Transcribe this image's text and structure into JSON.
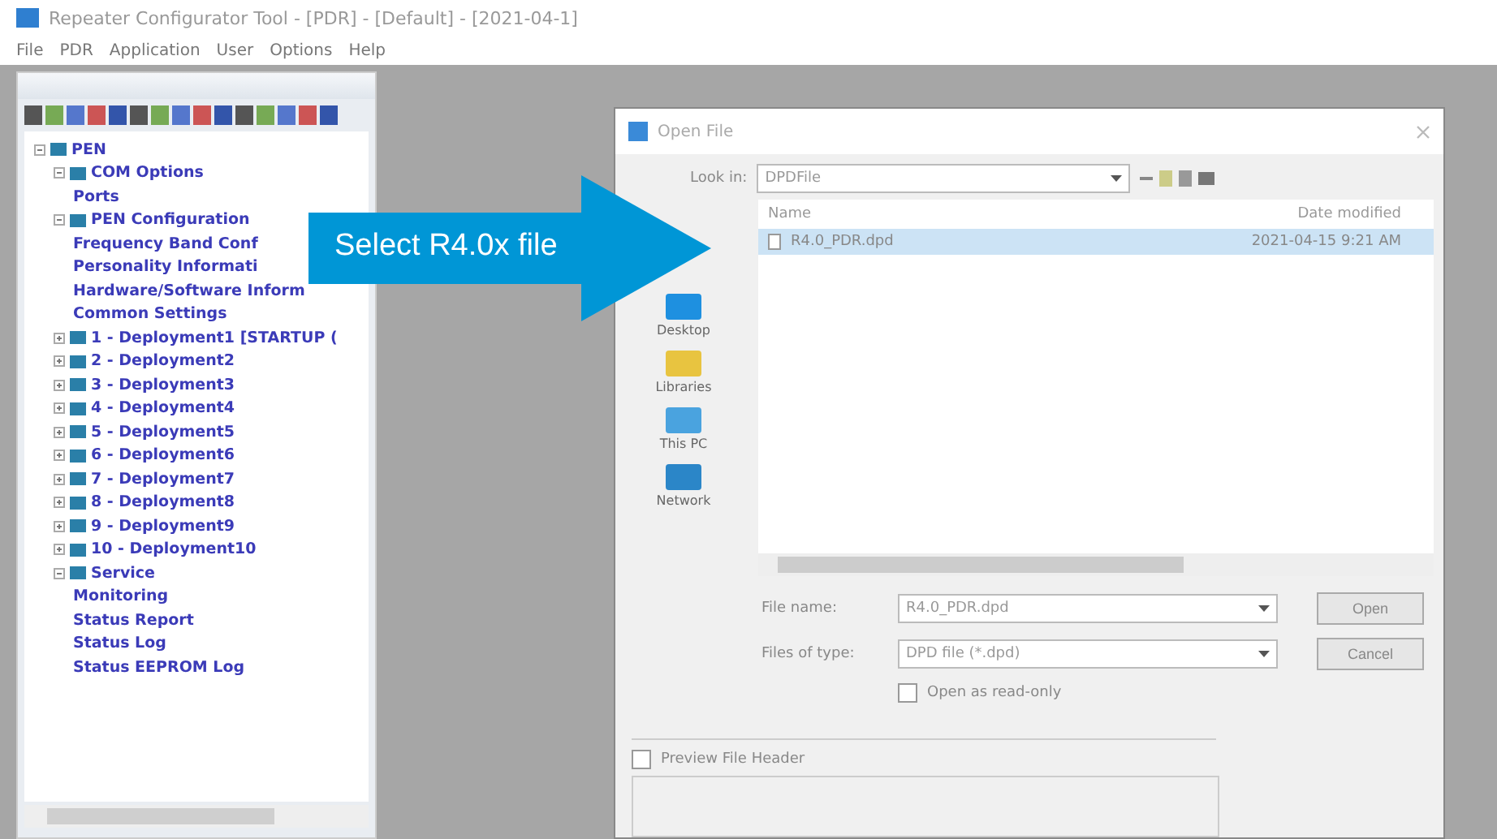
{
  "window": {
    "title": "Repeater Configurator Tool - [PDR] - [Default] - [2021-04-1]"
  },
  "menu": [
    "File",
    "PDR",
    "Application",
    "User",
    "Options",
    "Help"
  ],
  "tree": [
    {
      "label": "PEN",
      "expanded": true,
      "children": [
        {
          "label": "COM Options",
          "expanded": true,
          "children": [
            {
              "label": "Ports"
            }
          ]
        },
        {
          "label": "PEN Configuration",
          "expanded": true,
          "children": [
            {
              "label": "Frequency Band Conf"
            },
            {
              "label": "Personality Informati"
            },
            {
              "label": "Hardware/Software Inform"
            },
            {
              "label": "Common Settings"
            }
          ]
        },
        {
          "label": "1 - Deployment1 [STARTUP (",
          "expanded": false
        },
        {
          "label": "2 - Deployment2",
          "expanded": false
        },
        {
          "label": "3 - Deployment3",
          "expanded": false
        },
        {
          "label": "4 - Deployment4",
          "expanded": false
        },
        {
          "label": "5 - Deployment5",
          "expanded": false
        },
        {
          "label": "6 - Deployment6",
          "expanded": false
        },
        {
          "label": "7 - Deployment7",
          "expanded": false
        },
        {
          "label": "8 - Deployment8",
          "expanded": false
        },
        {
          "label": "9 - Deployment9",
          "expanded": false
        },
        {
          "label": "10 - Deployment10",
          "expanded": false
        },
        {
          "label": "Service",
          "expanded": true,
          "children": [
            {
              "label": "Monitoring"
            },
            {
              "label": "Status Report"
            },
            {
              "label": "Status Log"
            },
            {
              "label": "Status EEPROM Log"
            }
          ]
        }
      ]
    }
  ],
  "dialog": {
    "title": "Open File",
    "look_in_label": "Look in:",
    "look_in_value": "DPDFile",
    "places": [
      {
        "label": "Desktop",
        "kind": "desktop"
      },
      {
        "label": "Libraries",
        "kind": "libraries"
      },
      {
        "label": "This PC",
        "kind": "pc"
      },
      {
        "label": "Network",
        "kind": "network"
      }
    ],
    "columns": [
      "Name",
      "Date modified"
    ],
    "files": [
      {
        "name": "R4.0_PDR.dpd",
        "date": "2021-04-15 9:21 AM",
        "selected": true
      }
    ],
    "file_name_label": "File name:",
    "file_name": "R4.0_PDR.dpd",
    "file_type_label": "Files of type:",
    "file_type": "DPD file (*.dpd)",
    "read_only": {
      "label": "Open as read-only",
      "checked": false
    },
    "buttons": [
      "Open",
      "Cancel"
    ],
    "preview": {
      "label": "Preview File Header",
      "checked": false
    }
  },
  "callout": {
    "text": "Select R4.0x file"
  }
}
